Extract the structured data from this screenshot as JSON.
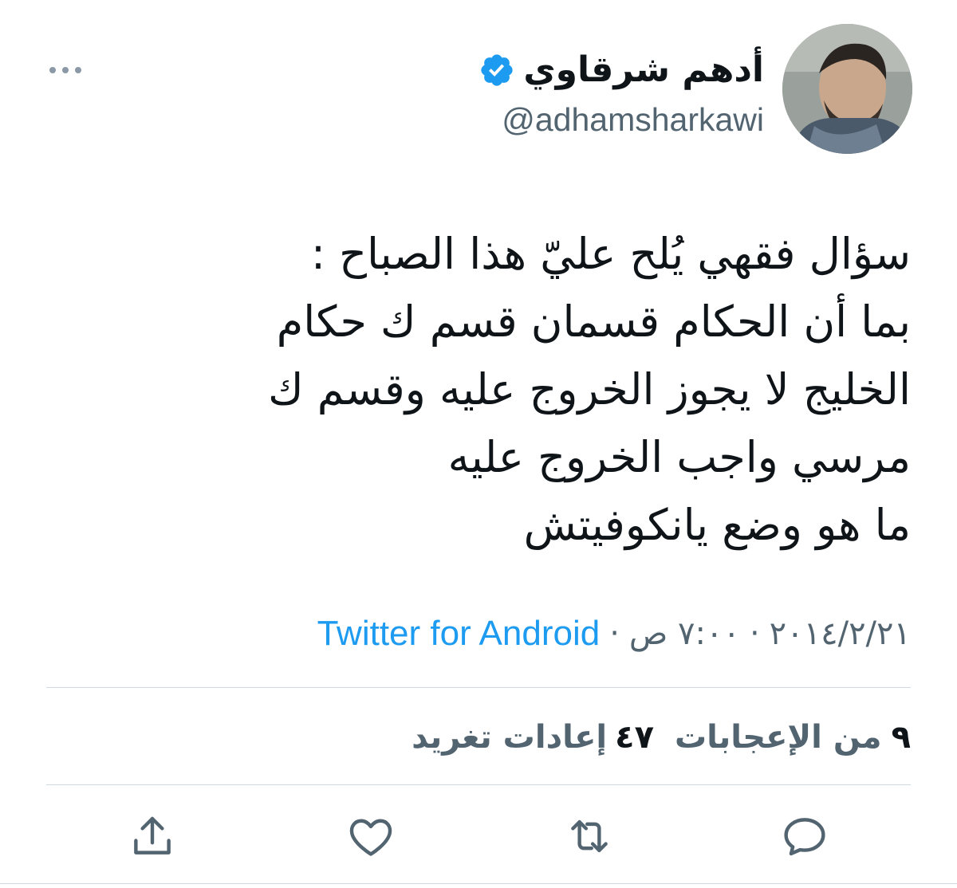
{
  "author": {
    "display_name": "أدهم شرقاوي",
    "handle": "@adhamsharkawi",
    "verified": true
  },
  "tweet": {
    "lines": [
      "سؤال فقهي يُلح عليّ هذا الصباح :",
      "بما أن الحكام قسمان قسم ك حكام",
      "الخليج لا يجوز الخروج عليه وقسم ك",
      "مرسي واجب الخروج عليه",
      "ما هو وضع يانكوفيتش"
    ]
  },
  "meta": {
    "date": "٢٠١٤/٢/٢١",
    "time": "٧:٠٠ ص",
    "separator": "·",
    "source": "Twitter for Android"
  },
  "stats": {
    "retweets_count": "٤٧",
    "retweets_label": "إعادات تغريد",
    "likes_count": "٩",
    "likes_label": "من الإعجابات"
  },
  "icons": {
    "more": "more-options-icon",
    "verified": "verified-badge-icon",
    "reply": "reply-icon",
    "retweet": "retweet-icon",
    "like": "like-icon",
    "share": "share-icon"
  },
  "colors": {
    "text": "#0f1419",
    "secondary": "#536471",
    "accent": "#1d9bf0",
    "divider": "#cfd9de"
  }
}
